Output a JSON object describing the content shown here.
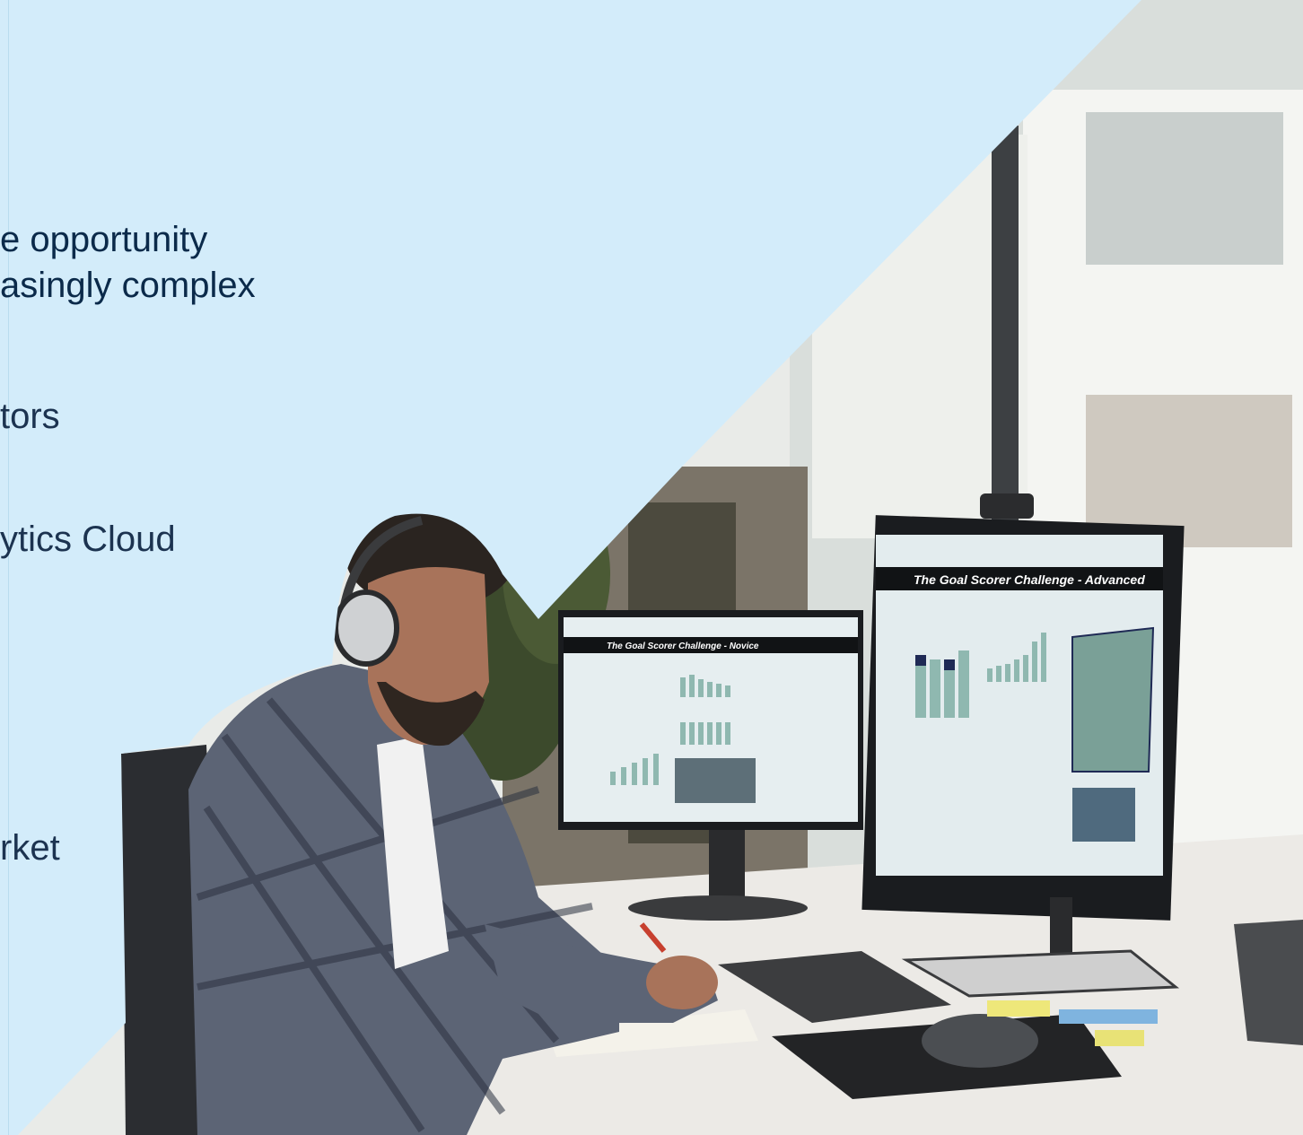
{
  "slide": {
    "text_lines": [
      "e opportunity",
      "asingly complex",
      "tors",
      "ytics Cloud",
      "rket"
    ]
  },
  "photo": {
    "left_monitor_title": "The Goal Scorer Challenge - Novice",
    "right_monitor_title": "The Goal Scorer Challenge - Advanced"
  },
  "colors": {
    "panel_blue": "#d3ecfa",
    "text_navy": "#0b2a4a"
  }
}
